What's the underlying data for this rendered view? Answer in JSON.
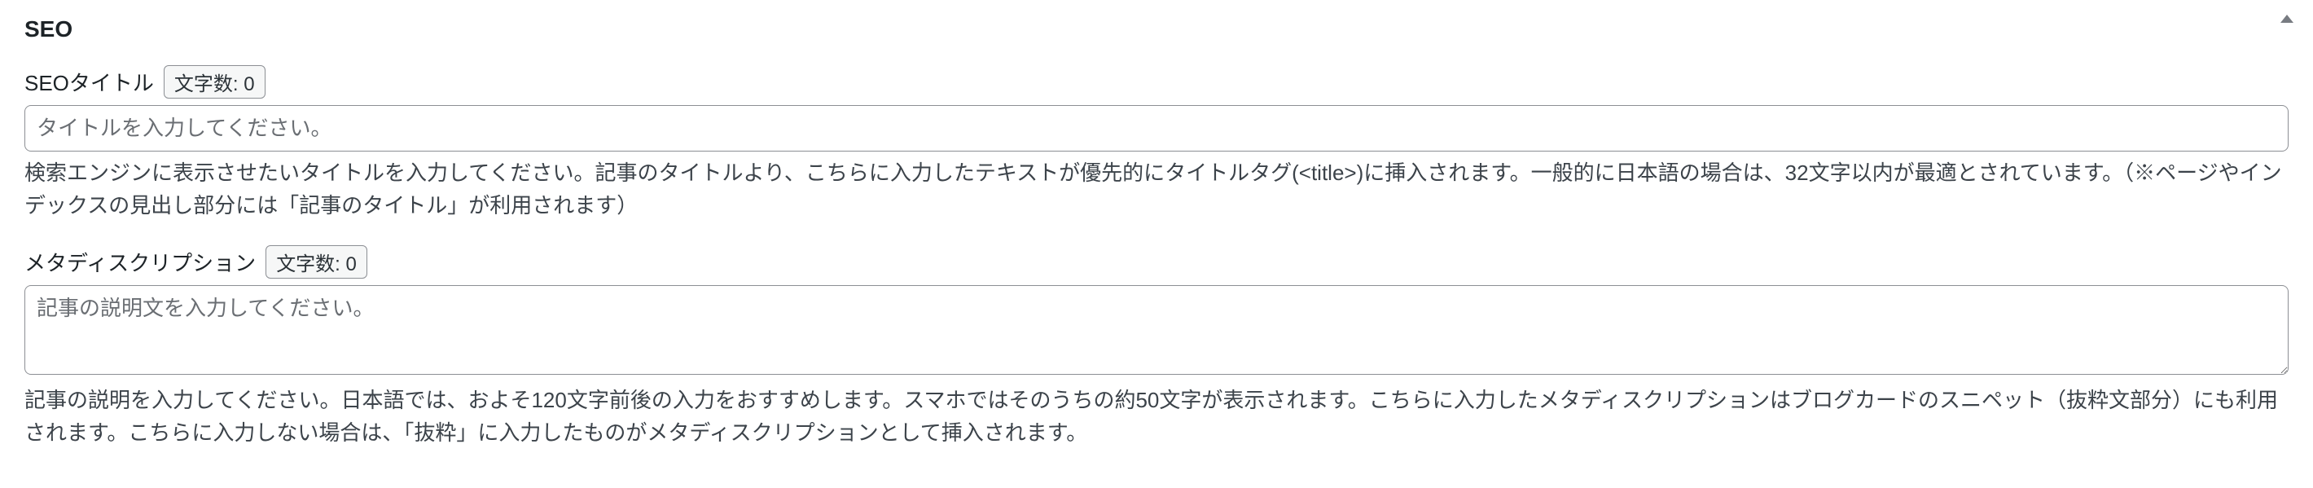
{
  "panel": {
    "title": "SEO"
  },
  "seo_title": {
    "label": "SEOタイトル",
    "char_count_label": "文字数: 0",
    "placeholder": "タイトルを入力してください。",
    "help": "検索エンジンに表示させたいタイトルを入力してください。記事のタイトルより、こちらに入力したテキストが優先的にタイトルタグ(<title>)に挿入されます。一般的に日本語の場合は、32文字以内が最適とされています。（※ページやインデックスの見出し部分には「記事のタイトル」が利用されます）"
  },
  "meta_description": {
    "label": "メタディスクリプション",
    "char_count_label": "文字数: 0",
    "placeholder": "記事の説明文を入力してください。",
    "help": "記事の説明を入力してください。日本語では、およそ120文字前後の入力をおすすめします。スマホではそのうちの約50文字が表示されます。こちらに入力したメタディスクリプションはブログカードのスニペット（抜粋文部分）にも利用されます。こちらに入力しない場合は、「抜粋」に入力したものがメタディスクリプションとして挿入されます。"
  }
}
